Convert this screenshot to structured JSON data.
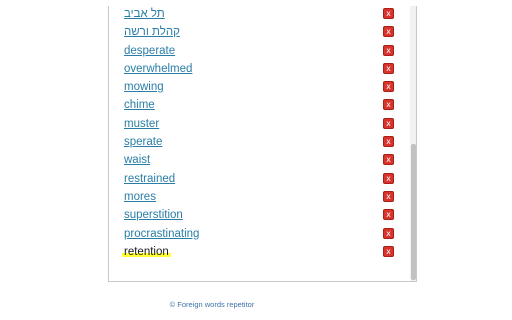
{
  "word_list": {
    "items": [
      {
        "word": "תל אביב",
        "rtl": true
      },
      {
        "word": "קהלת ורשה",
        "rtl": true
      },
      {
        "word": "desperate",
        "rtl": false
      },
      {
        "word": "overwhelmed",
        "rtl": false
      },
      {
        "word": "mowing",
        "rtl": false
      },
      {
        "word": "chime",
        "rtl": false
      },
      {
        "word": "muster",
        "rtl": false
      },
      {
        "word": "sperate",
        "rtl": false
      },
      {
        "word": "waist",
        "rtl": false
      },
      {
        "word": "restrained",
        "rtl": false
      },
      {
        "word": "mores",
        "rtl": false
      },
      {
        "word": "superstition",
        "rtl": false
      },
      {
        "word": "procrastinating",
        "rtl": false
      },
      {
        "word": "retention",
        "rtl": false,
        "highlighted": true
      }
    ],
    "delete_label": "x"
  },
  "footer": {
    "text": "© Foreign words repetitor"
  },
  "colors": {
    "link": "#2a7ea6",
    "delete_button": "#d9342b",
    "highlight": "#ffff33",
    "footer": "#3f72a8"
  },
  "icons": {
    "delete": "close-icon"
  }
}
